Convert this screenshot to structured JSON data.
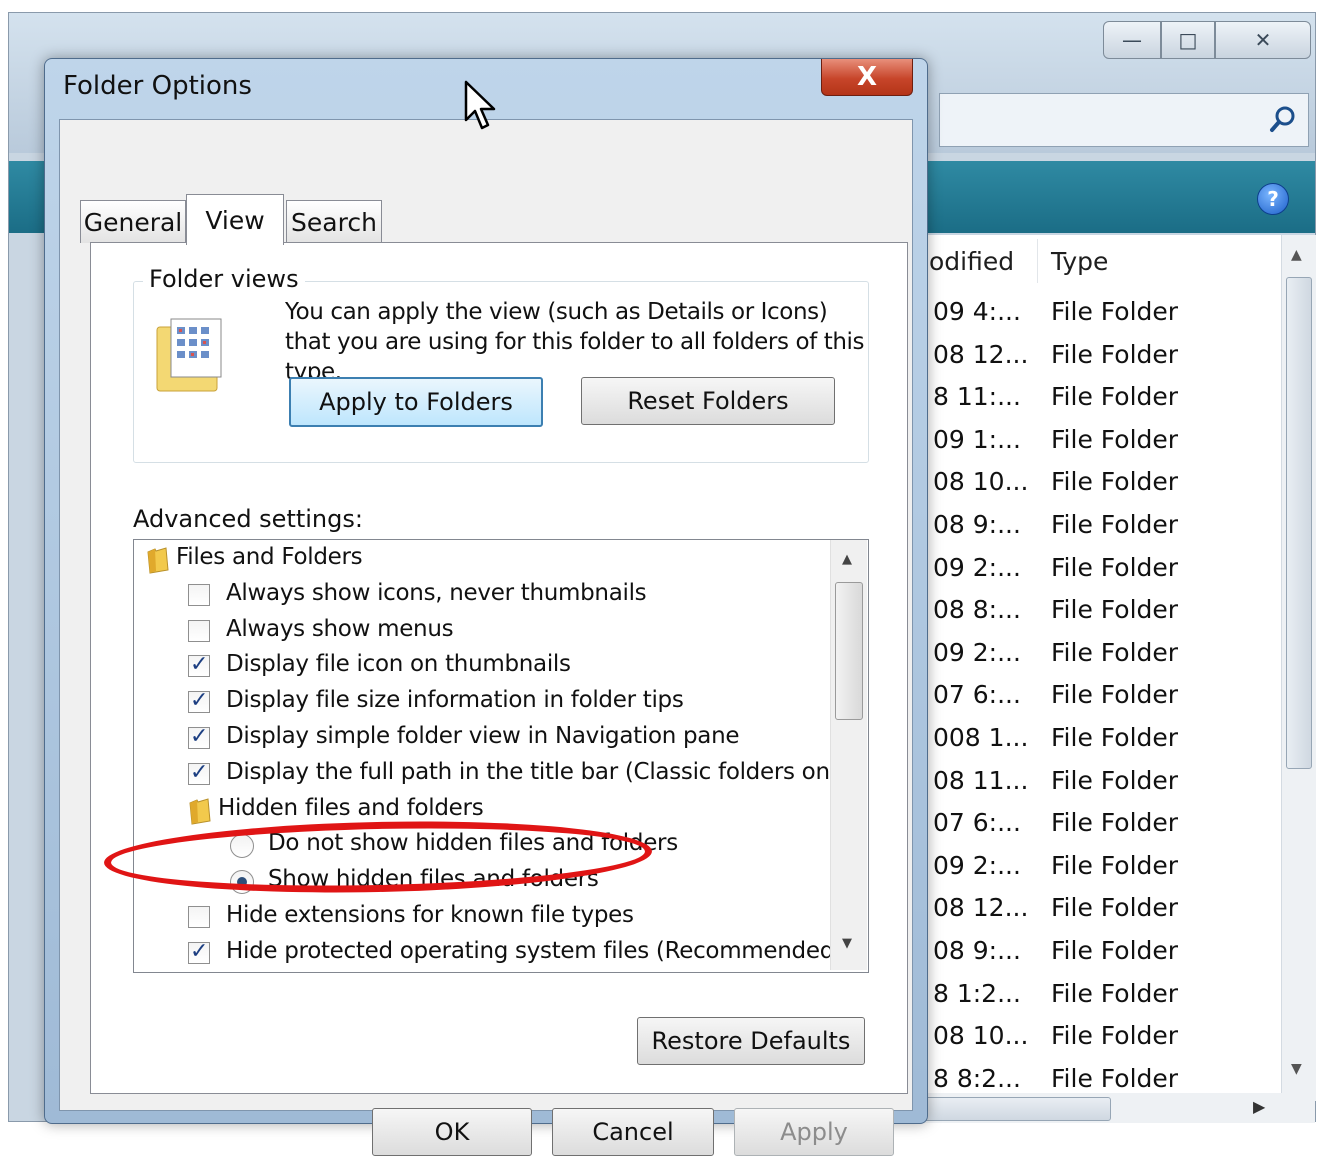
{
  "explorer": {
    "window_buttons": {
      "minimize": "—",
      "maximize": "□",
      "close": "✕"
    },
    "columns": {
      "modified": "odified",
      "type": "Type"
    },
    "rows": [
      {
        "modified": "09 4:...",
        "type": "File Folder"
      },
      {
        "modified": "08 12...",
        "type": "File Folder"
      },
      {
        "modified": "8 11:...",
        "type": "File Folder"
      },
      {
        "modified": "09 1:...",
        "type": "File Folder"
      },
      {
        "modified": "08 10...",
        "type": "File Folder"
      },
      {
        "modified": "08 9:...",
        "type": "File Folder"
      },
      {
        "modified": "09 2:...",
        "type": "File Folder"
      },
      {
        "modified": "08 8:...",
        "type": "File Folder"
      },
      {
        "modified": "09 2:...",
        "type": "File Folder"
      },
      {
        "modified": "07 6:...",
        "type": "File Folder"
      },
      {
        "modified": "008 1...",
        "type": "File Folder"
      },
      {
        "modified": "08 11...",
        "type": "File Folder"
      },
      {
        "modified": "07 6:...",
        "type": "File Folder"
      },
      {
        "modified": "09 2:...",
        "type": "File Folder"
      },
      {
        "modified": "08 12...",
        "type": "File Folder"
      },
      {
        "modified": "08 9:...",
        "type": "File Folder"
      },
      {
        "modified": "8 1:2...",
        "type": "File Folder"
      },
      {
        "modified": "08 10...",
        "type": "File Folder"
      },
      {
        "modified": "8 8:2...",
        "type": "File Folder"
      }
    ],
    "help_glyph": "?"
  },
  "dialog": {
    "title": "Folder Options",
    "close_glyph": "X",
    "tabs": [
      "General",
      "View",
      "Search"
    ],
    "active_tab": "View",
    "folder_views": {
      "label": "Folder views",
      "description": "You can apply the view (such as Details or Icons) that you are using for this folder to all folders of this type.",
      "apply_button": "Apply to Folders",
      "reset_button": "Reset Folders"
    },
    "advanced_label": "Advanced settings:",
    "tree": [
      {
        "kind": "folder",
        "level": 0,
        "label": "Files and Folders"
      },
      {
        "kind": "check",
        "level": 1,
        "checked": false,
        "label": "Always show icons, never thumbnails"
      },
      {
        "kind": "check",
        "level": 1,
        "checked": false,
        "label": "Always show menus"
      },
      {
        "kind": "check",
        "level": 1,
        "checked": true,
        "label": "Display file icon on thumbnails"
      },
      {
        "kind": "check",
        "level": 1,
        "checked": true,
        "label": "Display file size information in folder tips"
      },
      {
        "kind": "check",
        "level": 1,
        "checked": true,
        "label": "Display simple folder view in Navigation pane"
      },
      {
        "kind": "check",
        "level": 1,
        "checked": true,
        "label": "Display the full path in the title bar (Classic folders only)"
      },
      {
        "kind": "folder",
        "level": 1,
        "label": "Hidden files and folders"
      },
      {
        "kind": "radio",
        "level": 2,
        "checked": false,
        "label": "Do not show hidden files and folders"
      },
      {
        "kind": "radio",
        "level": 2,
        "checked": true,
        "label": "Show hidden files and folders"
      },
      {
        "kind": "check",
        "level": 1,
        "checked": false,
        "label": "Hide extensions for known file types"
      },
      {
        "kind": "check",
        "level": 1,
        "checked": true,
        "label": "Hide protected operating system files (Recommended)"
      }
    ],
    "restore_button": "Restore Defaults",
    "ok_button": "OK",
    "cancel_button": "Cancel",
    "apply_button": "Apply"
  },
  "colors": {
    "highlight_ellipse": "#e01515",
    "toolbar": "#1b6d86",
    "check": "#1d3f82"
  }
}
